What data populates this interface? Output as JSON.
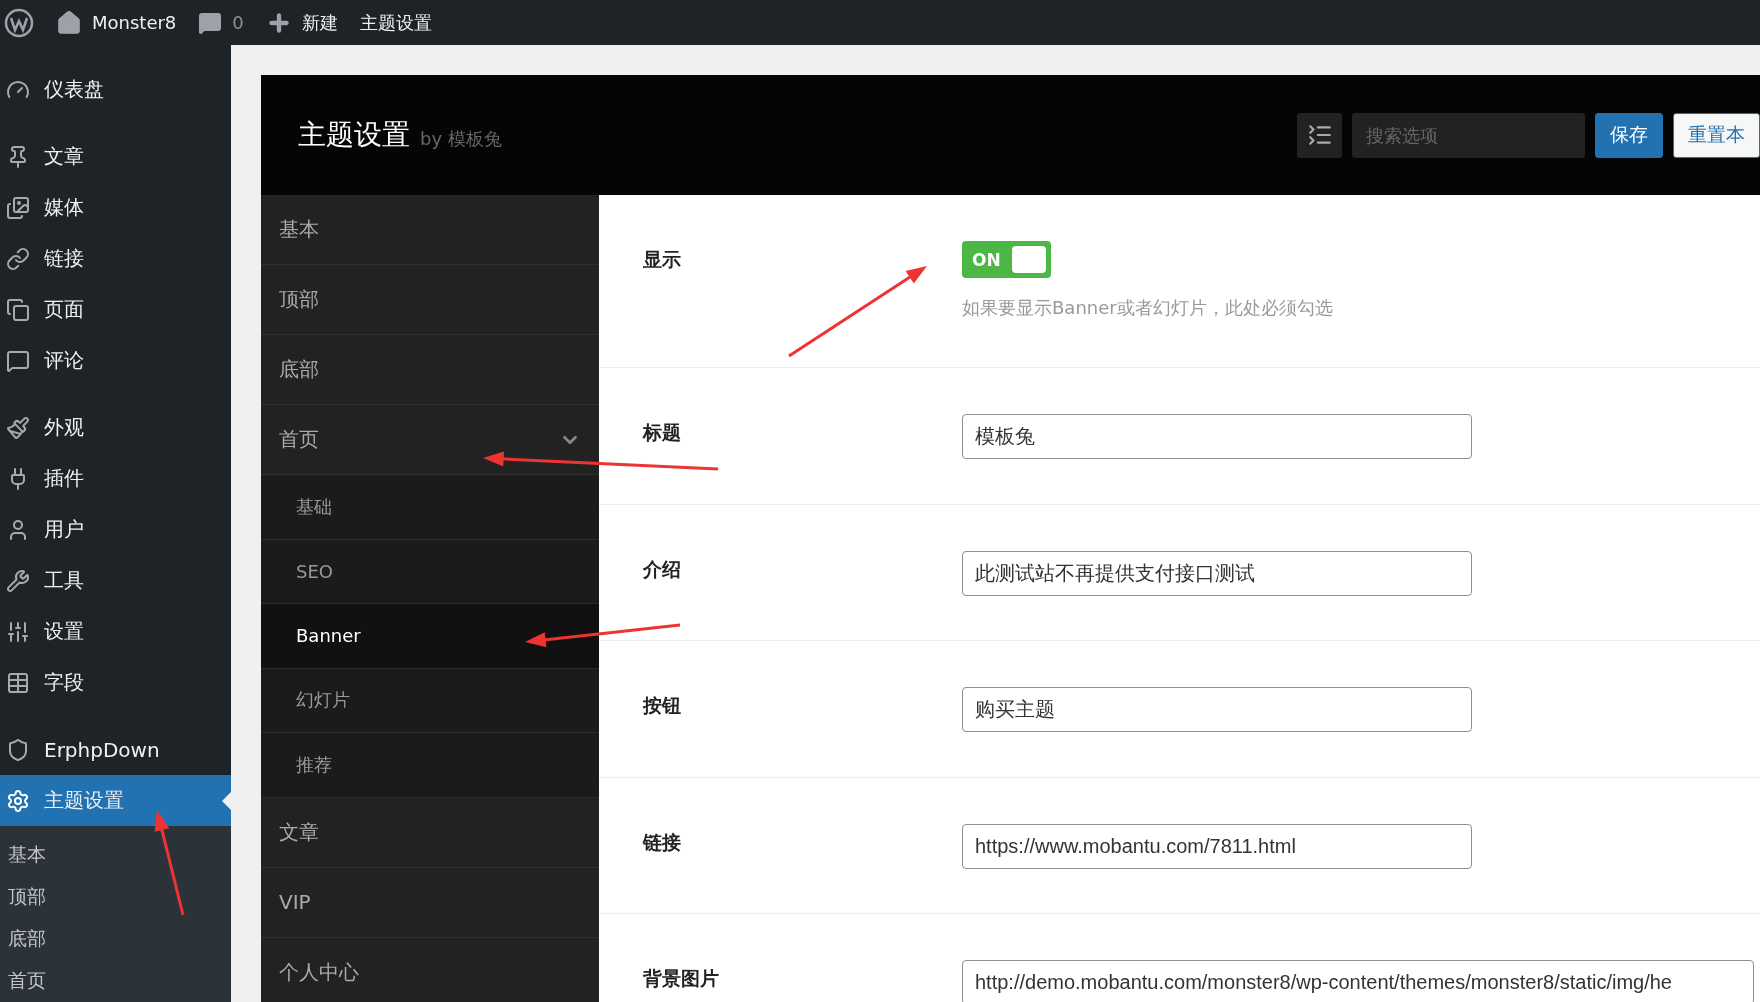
{
  "admin_bar": {
    "site_name": "Monster8",
    "comments_count": "0",
    "new_label": "新建",
    "page_label": "主题设置"
  },
  "admin_menu": {
    "groups": [
      {
        "items": [
          {
            "label": "仪表盘",
            "selected": false
          }
        ]
      },
      {
        "items": [
          {
            "label": "文章",
            "selected": false
          },
          {
            "label": "媒体",
            "selected": false
          },
          {
            "label": "链接",
            "selected": false
          },
          {
            "label": "页面",
            "selected": false
          },
          {
            "label": "评论",
            "selected": false
          }
        ]
      },
      {
        "items": [
          {
            "label": "外观",
            "selected": false
          },
          {
            "label": "插件",
            "selected": false
          },
          {
            "label": "用户",
            "selected": false
          },
          {
            "label": "工具",
            "selected": false
          },
          {
            "label": "设置",
            "selected": false
          },
          {
            "label": "字段",
            "selected": false
          }
        ]
      },
      {
        "items": [
          {
            "label": "ErphpDown",
            "selected": false
          },
          {
            "label": "主题设置",
            "selected": true
          }
        ]
      }
    ],
    "submenu": [
      {
        "label": "基本"
      },
      {
        "label": "顶部"
      },
      {
        "label": "底部"
      },
      {
        "label": "首页"
      }
    ]
  },
  "panel": {
    "title": "主题设置",
    "byline": "by 模板兔",
    "search": {
      "placeholder": "搜索选项"
    },
    "save_button": "保存",
    "reset_button": "重置本"
  },
  "sections": [
    {
      "label": "基本"
    },
    {
      "label": "顶部"
    },
    {
      "label": "底部"
    },
    {
      "label": "首页",
      "expanded": true,
      "children": [
        {
          "label": "基础",
          "selected": false
        },
        {
          "label": "SEO",
          "selected": false
        },
        {
          "label": "Banner",
          "selected": true
        },
        {
          "label": "幻灯片",
          "selected": false
        },
        {
          "label": "推荐",
          "selected": false
        }
      ]
    },
    {
      "label": "文章"
    },
    {
      "label": "VIP"
    },
    {
      "label": "个人中心"
    }
  ],
  "fields": [
    {
      "kind": "switch",
      "label": "显示",
      "on": true,
      "switch_text": "ON",
      "description": "如果要显示Banner或者幻灯片，此处必须勾选"
    },
    {
      "kind": "text",
      "label": "标题",
      "value": "模板兔"
    },
    {
      "kind": "text",
      "label": "介绍",
      "value": "此测试站不再提供支付接口测试"
    },
    {
      "kind": "text",
      "label": "按钮",
      "value": "购买主题"
    },
    {
      "kind": "text",
      "label": "链接",
      "value": "https://www.mobantu.com/7811.html"
    },
    {
      "kind": "upload",
      "label": "背景图片",
      "value": "http://demo.mobantu.com/monster8/wp-content/themes/monster8/static/img/he"
    }
  ]
}
